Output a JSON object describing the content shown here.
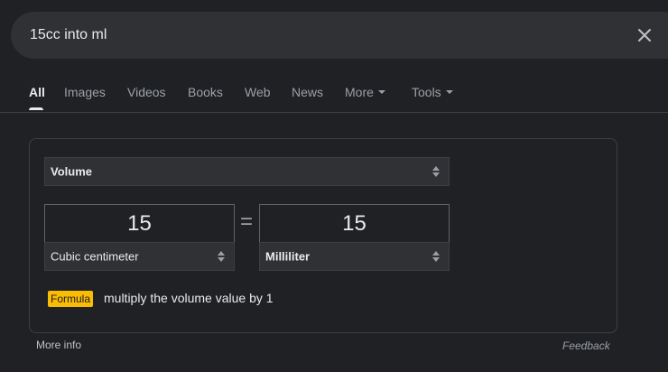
{
  "search": {
    "query": "15cc into ml"
  },
  "tabs": [
    {
      "label": "All"
    },
    {
      "label": "Images"
    },
    {
      "label": "Videos"
    },
    {
      "label": "Books"
    },
    {
      "label": "Web"
    },
    {
      "label": "News"
    },
    {
      "label": "More"
    },
    {
      "label": "Tools"
    }
  ],
  "converter": {
    "category": "Volume",
    "from": {
      "value": "15",
      "unit": "Cubic centimeter"
    },
    "equals": "=",
    "to": {
      "value": "15",
      "unit": "Milliliter"
    },
    "formula_badge": "Formula",
    "formula_text": "multiply the volume value by 1"
  },
  "footer": {
    "more_info": "More info",
    "feedback": "Feedback"
  },
  "colors": {
    "background": "#202124",
    "surface": "#303134",
    "formula_badge": "#fbbc04"
  }
}
